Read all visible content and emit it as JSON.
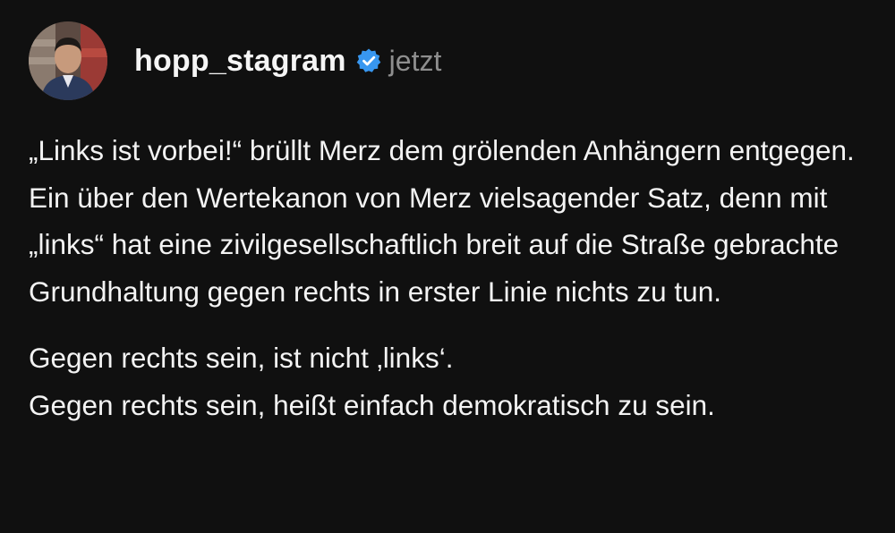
{
  "post": {
    "username": "hopp_stagram",
    "verified_icon": "verified-badge-icon",
    "timestamp": "jetzt",
    "caption_paragraph_1": "„Links ist vorbei!“ brüllt Merz dem grölenden Anhängern entgegen. Ein über den Wertekanon von Merz vielsagender Satz, denn mit „links“ hat eine zivilgesellschaftlich breit auf die Straße gebrachte Grundhaltung gegen rechts in erster Linie nichts zu tun.",
    "caption_line_2": "Gegen rechts sein, ist nicht ‚links‘.",
    "caption_line_3": "Gegen rechts sein, heißt einfach demokratisch zu sein."
  },
  "colors": {
    "background": "#101010",
    "text": "#f3f3f3",
    "muted": "#8e8e8e",
    "verified": "#3897f0"
  }
}
